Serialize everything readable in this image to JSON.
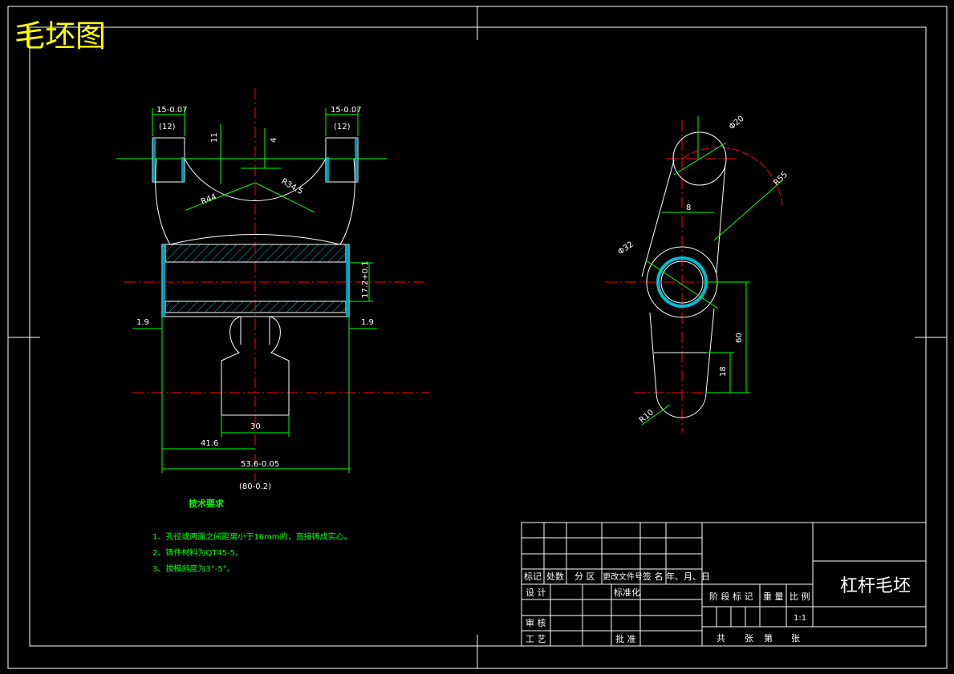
{
  "title": "毛坯图",
  "front_view": {
    "dims": {
      "top_left_w": "15-0.07",
      "top_left_paren": "(12)",
      "top_right_w": "15-0.07",
      "top_right_paren": "(12)",
      "d11": "11",
      "d4": "4",
      "r345": "R34.5",
      "r44": "R44",
      "d172": "17.2+0.1",
      "left19": "1.9",
      "right19": "1.9",
      "d30": "30",
      "d416": "41.6",
      "d536": "53.6-0.05",
      "d80": "(80-0.2)"
    }
  },
  "side_view": {
    "dims": {
      "phi20": "Φ20",
      "r55": "R55",
      "d8": "8",
      "phi32": "Φ32",
      "d60": "60",
      "d18": "18",
      "r10": "R10"
    }
  },
  "notes": {
    "heading": "技术要求",
    "items": [
      "1、孔径或两面之间距离小于16mm的，直接铸成实心。",
      "2、铸件材料为QT45-5。",
      "3、拔模斜度为3°-5°。"
    ]
  },
  "title_block": {
    "part_name": "杠杆毛坯",
    "scale": "1:1",
    "headers": [
      "标记",
      "处数",
      "分 区",
      "更改文件号",
      "签 名",
      "年、月、日"
    ],
    "design": "设 计",
    "standardization": "标准化",
    "review": "审 核",
    "process": "工 艺",
    "approve": "批 准",
    "stage_mark": "阶 段 标 记",
    "weight": "重 量",
    "ratio": "比 例",
    "total": "共",
    "sheets": "张",
    "page": "第",
    "sheet2": "张"
  }
}
